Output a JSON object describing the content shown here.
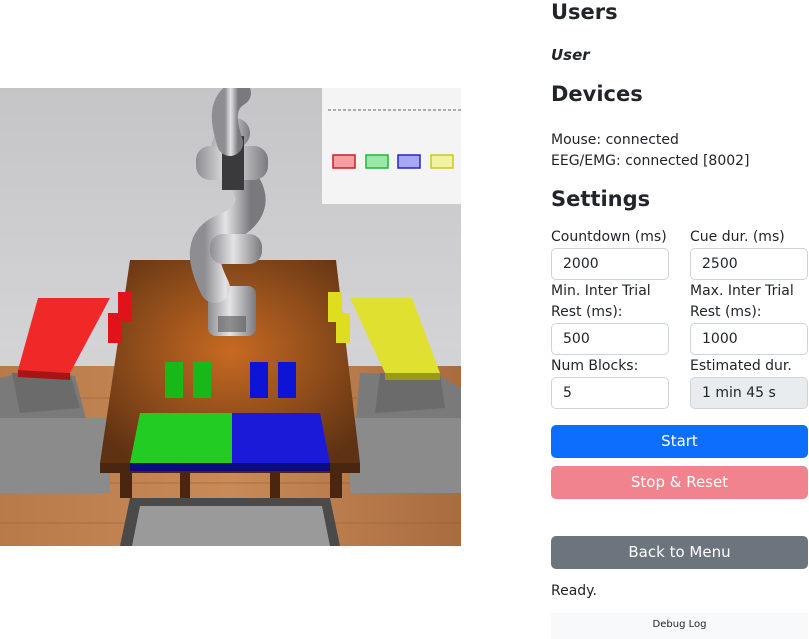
{
  "headings": {
    "users": "Users",
    "devices": "Devices",
    "settings": "Settings"
  },
  "users": {
    "current": "User"
  },
  "devices": {
    "mouse": "Mouse: connected",
    "eeg": "EEG/EMG: connected [8002]"
  },
  "settings": {
    "countdown": {
      "label": "Countdown (ms)",
      "value": "2000"
    },
    "cue_duration": {
      "label": "Cue dur. (ms)",
      "value": "2500"
    },
    "min_rest": {
      "label": "Min. Inter Trial Rest (ms):",
      "value": "500"
    },
    "max_rest": {
      "label": "Max. Inter Trial Rest (ms):",
      "value": "1000"
    },
    "num_blocks": {
      "label": "Num Blocks:",
      "value": "5"
    },
    "estimated": {
      "label": "Estimated dur.",
      "value": "1 min 45 s"
    }
  },
  "buttons": {
    "start": "Start",
    "stop_reset": "Stop & Reset",
    "back_to_menu": "Back to Menu"
  },
  "status": "Ready.",
  "debug_log": "Debug Log",
  "colors": {
    "primary": "#0d6efd",
    "danger_light": "#f0838e",
    "secondary": "#6c757d",
    "block_red": "#e0121a",
    "block_green": "#18b818",
    "block_blue": "#0e14d6",
    "block_yellow": "#dede1e"
  },
  "scene": {
    "cue_markers": [
      "red",
      "green",
      "blue",
      "yellow"
    ]
  }
}
